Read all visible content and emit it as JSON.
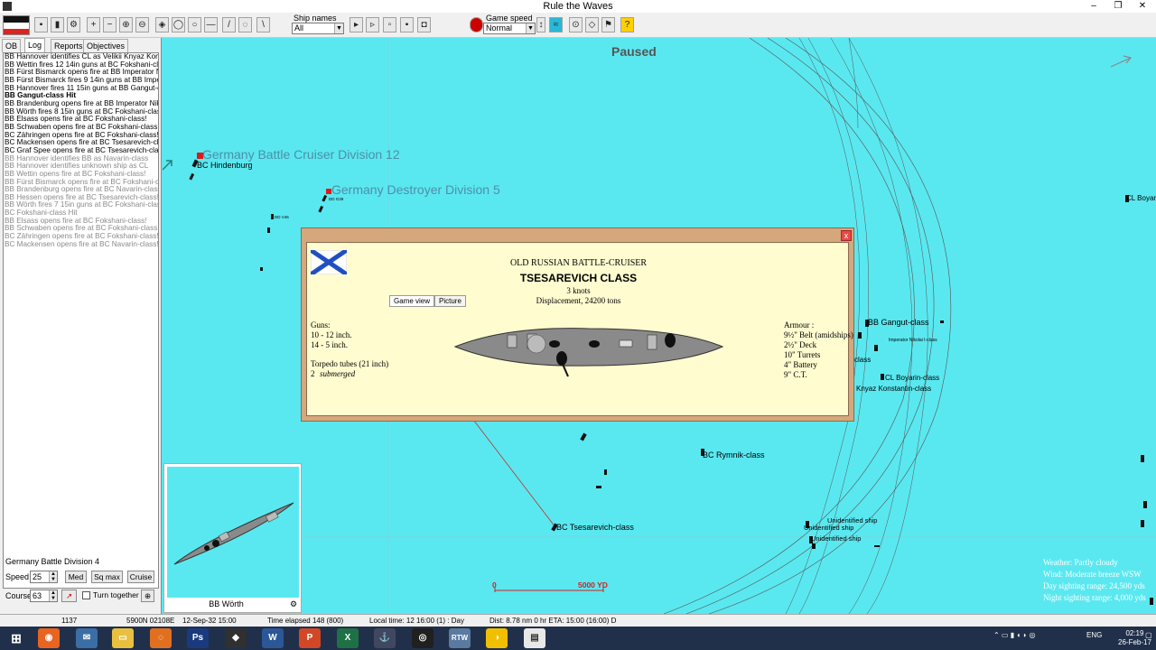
{
  "window": {
    "title": "Rule the Waves",
    "minimize": "–",
    "restore": "❐",
    "close": "✕"
  },
  "toolbar": {
    "ship_names_label": "Ship names",
    "ship_names_value": "All",
    "game_speed_label": "Game speed",
    "game_speed_value": "Normal",
    "help_glyph": "?"
  },
  "left": {
    "tabs": [
      "OB",
      "Log",
      "Reports",
      "Objectives"
    ],
    "active_tab": "Log",
    "log": [
      {
        "text": "BB Hannover identifies CL as Velikii Knyaz Konstantin",
        "style": "normal"
      },
      {
        "text": "BB Wettin fires 12 14in guns at BC Fokshani-class! T",
        "style": "normal"
      },
      {
        "text": "BB Fürst Bismarck opens fire at BB Imperator Nikolai",
        "style": "normal"
      },
      {
        "text": "BB Fürst Bismarck fires 9 14in guns at BB Imperator N",
        "style": "normal"
      },
      {
        "text": "BB Hannover fires 11 15in guns at BB Gangut-class!",
        "style": "normal"
      },
      {
        "text": "BB Gangut-class Hit",
        "style": "bold"
      },
      {
        "text": "BB Brandenburg opens fire at BB Imperator Nikolai I+",
        "style": "normal"
      },
      {
        "text": "BB Wörth fires 8 15in guns at BC Fokshani-class! Ta",
        "style": "normal"
      },
      {
        "text": "BB Elsass opens fire at BC Fokshani-class!",
        "style": "normal"
      },
      {
        "text": "BB Schwaben opens fire at BC Fokshani-class!",
        "style": "normal"
      },
      {
        "text": "BC Zähringen opens fire at BC Fokshani-class!",
        "style": "normal"
      },
      {
        "text": "BC Mackensen opens fire at BC Tsesarevich-class!",
        "style": "normal"
      },
      {
        "text": "BC Graf Spee opens fire at BC Tsesarevich-class!",
        "style": "normal"
      },
      {
        "text": "BB Hannover identifies BB as Navarin-class",
        "style": "grey"
      },
      {
        "text": "BB Hannover identifies unknown ship as CL",
        "style": "grey"
      },
      {
        "text": "BB Wettin opens fire at BC Fokshani-class!",
        "style": "grey"
      },
      {
        "text": "BB Fürst Bismarck opens fire at BC Fokshani-class!",
        "style": "grey"
      },
      {
        "text": "BB Brandenburg opens fire at BC Navarin-class!",
        "style": "grey"
      },
      {
        "text": "BB Hessen opens fire at BC Tsesarevich-class!",
        "style": "grey"
      },
      {
        "text": "BB Wörth fires 7 15in guns at BC Fokshani-class! Ta",
        "style": "grey"
      },
      {
        "text": "BC Fokshani-class Hit",
        "style": "grey"
      },
      {
        "text": "BB Elsass opens fire at BC Fokshani-class!",
        "style": "grey"
      },
      {
        "text": "BB Schwaben opens fire at BC Fokshani-class!",
        "style": "grey"
      },
      {
        "text": "BC Zähringen opens fire at BC Fokshani-class!",
        "style": "grey"
      },
      {
        "text": "BC Mackensen opens fire at BC Navarin-class!",
        "style": "grey"
      }
    ],
    "division": "Germany Battle Division 4",
    "speed_label": "Speed",
    "speed_value": "25",
    "course_label": "Course",
    "course_value": "63",
    "btn_med": "Med",
    "btn_sqmax": "Sq max",
    "btn_cruise": "Cruise",
    "turn_together": "Turn together"
  },
  "map": {
    "paused": "Paused",
    "divisions": [
      "Germany Battle Cruiser Division 12",
      "Germany Destroyer Division 5"
    ],
    "ship_labels": {
      "hindenburg": "BC Hindenburg",
      "gangut": "BB Gangut-class",
      "boyarin": "CL Boyarin-class",
      "konstantin": "Knyaz Konstantin-class",
      "rymnik": "BC Rymnik-class",
      "tsesarevich": "BC Tsesarevich-class",
      "unid1": "Unidentified ship",
      "unid2": "Unidentified ship",
      "unid3": "Unidentified ship",
      "cl_boyarin_edge": "CL Boyari",
      "class_frag": "class",
      "imperator": "Imperator Nikolai I-class",
      "small1": "DD V46",
      "small2": "DD G39"
    },
    "scale_start": "0",
    "scale_end": "5000 YD",
    "info": {
      "weather": "Weather: Partly cloudy",
      "wind": "Wind: Moderate breeze  WSW",
      "day_range": "Day sighting range: 24,500 yds",
      "night_range": "Night sighting range: 4,000 yds"
    }
  },
  "dialog": {
    "close": "x",
    "subtitle": "OLD RUSSIAN BATTLE-CRUISER",
    "title": "TSESAREVICH CLASS",
    "speed": "3 knots",
    "displacement": "Displacement, 24200 tons",
    "tab_game_view": "Game view",
    "tab_picture": "Picture",
    "guns_label": "Guns:",
    "guns": [
      "10 - 12 inch.",
      "14 - 5 inch."
    ],
    "torpedo_label": "Torpedo tubes (21 inch)",
    "torpedo_count": "2",
    "torpedo_type": "submerged",
    "armour_label": "Armour :",
    "armour": [
      "9½\" Belt (amidships)",
      "2½\" Deck",
      "10\" Turrets",
      "4\" Battery",
      "9\" C.T."
    ]
  },
  "minimap": {
    "ship_name": "BB Wörth"
  },
  "status": {
    "s1": "1137",
    "s2": "5900N 02108E",
    "s3": "12-Sep-32 15:00",
    "s4": "Time elapsed 148 (800)",
    "s5": "Local time: 12 16:00 (1) : Day",
    "s6": "Dist: 8.78 nm 0 hr ETA: 15:00 (16:00) D"
  },
  "taskbar": {
    "lang": "ENG",
    "time": "02:19",
    "date": "26-Feb-17"
  },
  "colors": {
    "sea": "#5ae8f0",
    "dialog_frame": "#d4a87c",
    "dialog_bg": "#fffcd0",
    "scale": "#d42020",
    "division_text": "#4d8fa8"
  }
}
